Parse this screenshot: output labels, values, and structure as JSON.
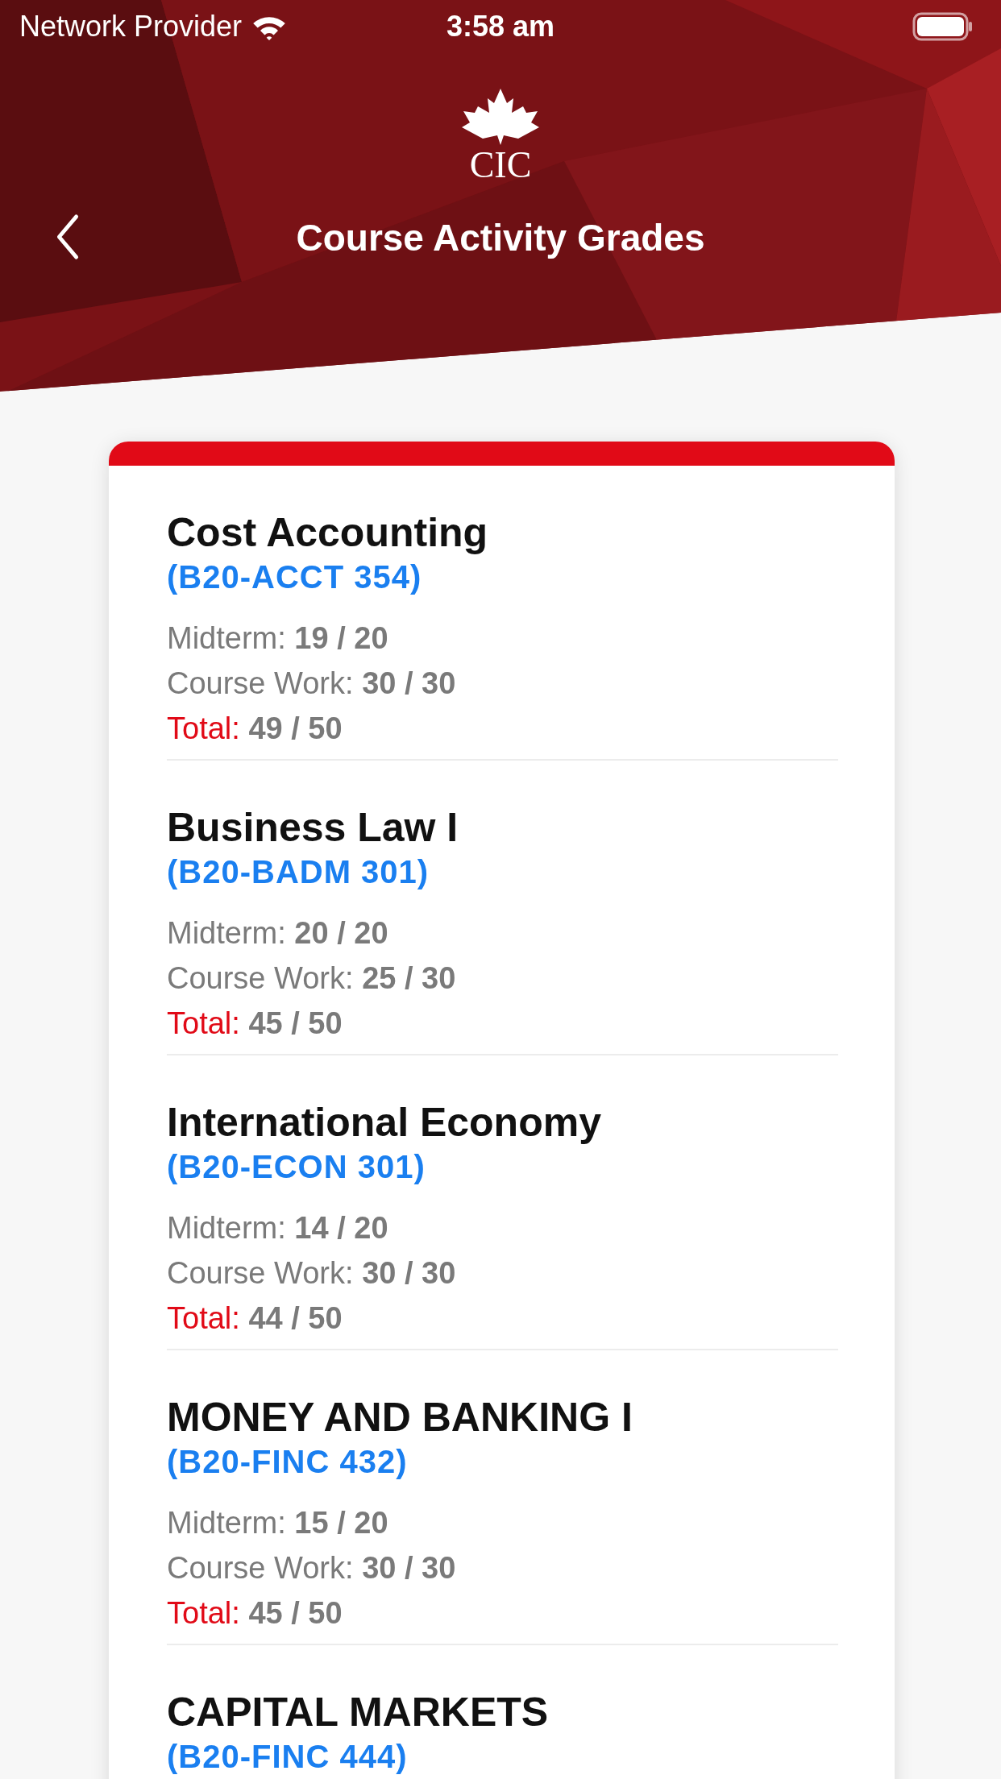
{
  "status_bar": {
    "carrier": "Network Provider",
    "time": "3:58 am"
  },
  "header": {
    "logo_text": "CIC",
    "title": "Course Activity Grades"
  },
  "courses": [
    {
      "name": "Cost Accounting",
      "code": "(B20-ACCT 354)",
      "grades": [
        {
          "kind": "score",
          "label": "Midterm:",
          "value": "19 / 20"
        },
        {
          "kind": "score",
          "label": "Course Work:",
          "value": "30 / 30"
        },
        {
          "kind": "total",
          "label": "Total:",
          "value": "49 / 50"
        }
      ]
    },
    {
      "name": "Business Law I",
      "code": "(B20-BADM 301)",
      "grades": [
        {
          "kind": "score",
          "label": "Midterm:",
          "value": "20 / 20"
        },
        {
          "kind": "score",
          "label": "Course Work:",
          "value": "25 / 30"
        },
        {
          "kind": "total",
          "label": "Total:",
          "value": "45 / 50"
        }
      ]
    },
    {
      "name": "International Economy",
      "code": "(B20-ECON 301)",
      "grades": [
        {
          "kind": "score",
          "label": "Midterm:",
          "value": "14 / 20"
        },
        {
          "kind": "score",
          "label": "Course Work:",
          "value": "30 / 30"
        },
        {
          "kind": "total",
          "label": "Total:",
          "value": "44 / 50"
        }
      ]
    },
    {
      "name": "MONEY AND BANKING I",
      "code": "(B20-FINC 432)",
      "grades": [
        {
          "kind": "score",
          "label": "Midterm:",
          "value": "15 / 20"
        },
        {
          "kind": "score",
          "label": "Course Work:",
          "value": "30 / 30"
        },
        {
          "kind": "total",
          "label": "Total:",
          "value": "45 / 50"
        }
      ]
    },
    {
      "name": "CAPITAL MARKETS",
      "code": "(B20-FINC 444)"
    }
  ]
}
